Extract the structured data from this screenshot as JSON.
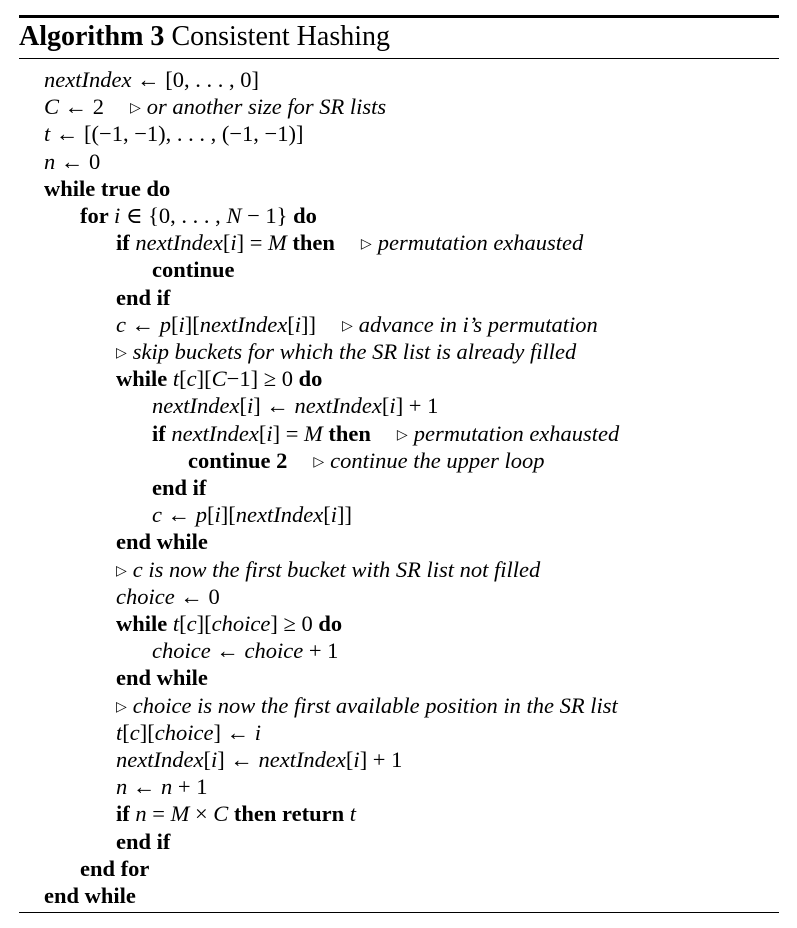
{
  "caption": {
    "label": "Algorithm 3",
    "title": "Consistent Hashing"
  },
  "comment_marker": "▷",
  "lines": [
    {
      "indent": 0,
      "parts": [
        {
          "t": "m",
          "v": "nextIndex"
        },
        {
          "t": "n",
          "v": " ← [0, . . . , 0]"
        }
      ]
    },
    {
      "indent": 0,
      "parts": [
        {
          "t": "m",
          "v": "C"
        },
        {
          "t": "n",
          "v": " ← 2"
        }
      ],
      "comment": "or another size for SR lists"
    },
    {
      "indent": 0,
      "parts": [
        {
          "t": "m",
          "v": "t"
        },
        {
          "t": "n",
          "v": " ← [(−1, −1), . . . , (−1, −1)]"
        }
      ]
    },
    {
      "indent": 0,
      "parts": [
        {
          "t": "m",
          "v": "n"
        },
        {
          "t": "n",
          "v": " ← 0"
        }
      ]
    },
    {
      "indent": 0,
      "parts": [
        {
          "t": "kw",
          "v": "while true do"
        }
      ]
    },
    {
      "indent": 1,
      "parts": [
        {
          "t": "kw",
          "v": "for "
        },
        {
          "t": "m",
          "v": "i"
        },
        {
          "t": "n",
          "v": " ∈ {0, . . . , "
        },
        {
          "t": "m",
          "v": "N"
        },
        {
          "t": "n",
          "v": " − 1} "
        },
        {
          "t": "kw",
          "v": "do"
        }
      ]
    },
    {
      "indent": 2,
      "parts": [
        {
          "t": "kw",
          "v": "if "
        },
        {
          "t": "m",
          "v": "nextIndex"
        },
        {
          "t": "n",
          "v": "["
        },
        {
          "t": "m",
          "v": "i"
        },
        {
          "t": "n",
          "v": "] = "
        },
        {
          "t": "m",
          "v": "M"
        },
        {
          "t": "kw",
          "v": " then"
        }
      ],
      "comment": "permutation exhausted"
    },
    {
      "indent": 3,
      "parts": [
        {
          "t": "kw",
          "v": "continue"
        }
      ]
    },
    {
      "indent": 2,
      "parts": [
        {
          "t": "kw",
          "v": "end if"
        }
      ]
    },
    {
      "indent": 2,
      "parts": [
        {
          "t": "m",
          "v": "c"
        },
        {
          "t": "n",
          "v": " ← "
        },
        {
          "t": "m",
          "v": "p"
        },
        {
          "t": "n",
          "v": "["
        },
        {
          "t": "m",
          "v": "i"
        },
        {
          "t": "n",
          "v": "]["
        },
        {
          "t": "m",
          "v": "nextIndex"
        },
        {
          "t": "n",
          "v": "["
        },
        {
          "t": "m",
          "v": "i"
        },
        {
          "t": "n",
          "v": "]]"
        }
      ],
      "comment": "advance in i’s permutation"
    },
    {
      "indent": 2,
      "parts": [],
      "comment": "skip buckets for which the SR list is already filled",
      "comment_only": true
    },
    {
      "indent": 2,
      "parts": [
        {
          "t": "kw",
          "v": "while "
        },
        {
          "t": "m",
          "v": "t"
        },
        {
          "t": "n",
          "v": "["
        },
        {
          "t": "m",
          "v": "c"
        },
        {
          "t": "n",
          "v": "]["
        },
        {
          "t": "m",
          "v": "C"
        },
        {
          "t": "n",
          "v": "−1] ≥ 0 "
        },
        {
          "t": "kw",
          "v": "do"
        }
      ]
    },
    {
      "indent": 3,
      "parts": [
        {
          "t": "m",
          "v": "nextIndex"
        },
        {
          "t": "n",
          "v": "["
        },
        {
          "t": "m",
          "v": "i"
        },
        {
          "t": "n",
          "v": "] ← "
        },
        {
          "t": "m",
          "v": "nextIndex"
        },
        {
          "t": "n",
          "v": "["
        },
        {
          "t": "m",
          "v": "i"
        },
        {
          "t": "n",
          "v": "] + 1"
        }
      ]
    },
    {
      "indent": 3,
      "parts": [
        {
          "t": "kw",
          "v": "if "
        },
        {
          "t": "m",
          "v": "nextIndex"
        },
        {
          "t": "n",
          "v": "["
        },
        {
          "t": "m",
          "v": "i"
        },
        {
          "t": "n",
          "v": "] = "
        },
        {
          "t": "m",
          "v": "M"
        },
        {
          "t": "kw",
          "v": " then"
        }
      ],
      "comment": "permutation exhausted"
    },
    {
      "indent": 4,
      "parts": [
        {
          "t": "kw",
          "v": "continue 2"
        }
      ],
      "comment": "continue the upper loop"
    },
    {
      "indent": 3,
      "parts": [
        {
          "t": "kw",
          "v": "end if"
        }
      ]
    },
    {
      "indent": 3,
      "parts": [
        {
          "t": "m",
          "v": "c"
        },
        {
          "t": "n",
          "v": " ← "
        },
        {
          "t": "m",
          "v": "p"
        },
        {
          "t": "n",
          "v": "["
        },
        {
          "t": "m",
          "v": "i"
        },
        {
          "t": "n",
          "v": "]["
        },
        {
          "t": "m",
          "v": "nextIndex"
        },
        {
          "t": "n",
          "v": "["
        },
        {
          "t": "m",
          "v": "i"
        },
        {
          "t": "n",
          "v": "]]"
        }
      ]
    },
    {
      "indent": 2,
      "parts": [
        {
          "t": "kw",
          "v": "end while"
        }
      ]
    },
    {
      "indent": 2,
      "parts": [],
      "comment": "c is now the first bucket with SR list not filled",
      "comment_only": true
    },
    {
      "indent": 2,
      "parts": [
        {
          "t": "m",
          "v": "choice"
        },
        {
          "t": "n",
          "v": " ← 0"
        }
      ]
    },
    {
      "indent": 2,
      "parts": [
        {
          "t": "kw",
          "v": "while "
        },
        {
          "t": "m",
          "v": "t"
        },
        {
          "t": "n",
          "v": "["
        },
        {
          "t": "m",
          "v": "c"
        },
        {
          "t": "n",
          "v": "]["
        },
        {
          "t": "m",
          "v": "choice"
        },
        {
          "t": "n",
          "v": "] ≥ 0 "
        },
        {
          "t": "kw",
          "v": "do"
        }
      ]
    },
    {
      "indent": 3,
      "parts": [
        {
          "t": "m",
          "v": "choice"
        },
        {
          "t": "n",
          "v": " ← "
        },
        {
          "t": "m",
          "v": "choice"
        },
        {
          "t": "n",
          "v": " + 1"
        }
      ]
    },
    {
      "indent": 2,
      "parts": [
        {
          "t": "kw",
          "v": "end while"
        }
      ]
    },
    {
      "indent": 2,
      "parts": [],
      "comment": "choice is now the first available position in the SR list",
      "comment_only": true
    },
    {
      "indent": 2,
      "parts": [
        {
          "t": "m",
          "v": "t"
        },
        {
          "t": "n",
          "v": "["
        },
        {
          "t": "m",
          "v": "c"
        },
        {
          "t": "n",
          "v": "]["
        },
        {
          "t": "m",
          "v": "choice"
        },
        {
          "t": "n",
          "v": "] ← "
        },
        {
          "t": "m",
          "v": "i"
        }
      ]
    },
    {
      "indent": 2,
      "parts": [
        {
          "t": "m",
          "v": "nextIndex"
        },
        {
          "t": "n",
          "v": "["
        },
        {
          "t": "m",
          "v": "i"
        },
        {
          "t": "n",
          "v": "] ← "
        },
        {
          "t": "m",
          "v": "nextIndex"
        },
        {
          "t": "n",
          "v": "["
        },
        {
          "t": "m",
          "v": "i"
        },
        {
          "t": "n",
          "v": "] + 1"
        }
      ]
    },
    {
      "indent": 2,
      "parts": [
        {
          "t": "m",
          "v": "n"
        },
        {
          "t": "n",
          "v": " ← "
        },
        {
          "t": "m",
          "v": "n"
        },
        {
          "t": "n",
          "v": " + 1"
        }
      ]
    },
    {
      "indent": 2,
      "parts": [
        {
          "t": "kw",
          "v": "if "
        },
        {
          "t": "m",
          "v": "n"
        },
        {
          "t": "n",
          "v": " = "
        },
        {
          "t": "m",
          "v": "M"
        },
        {
          "t": "n",
          "v": " × "
        },
        {
          "t": "m",
          "v": "C"
        },
        {
          "t": "kw",
          "v": " then return "
        },
        {
          "t": "m",
          "v": "t"
        }
      ]
    },
    {
      "indent": 2,
      "parts": [
        {
          "t": "kw",
          "v": "end if"
        }
      ]
    },
    {
      "indent": 1,
      "parts": [
        {
          "t": "kw",
          "v": "end for"
        }
      ]
    },
    {
      "indent": 0,
      "parts": [
        {
          "t": "kw",
          "v": "end while"
        }
      ]
    }
  ]
}
